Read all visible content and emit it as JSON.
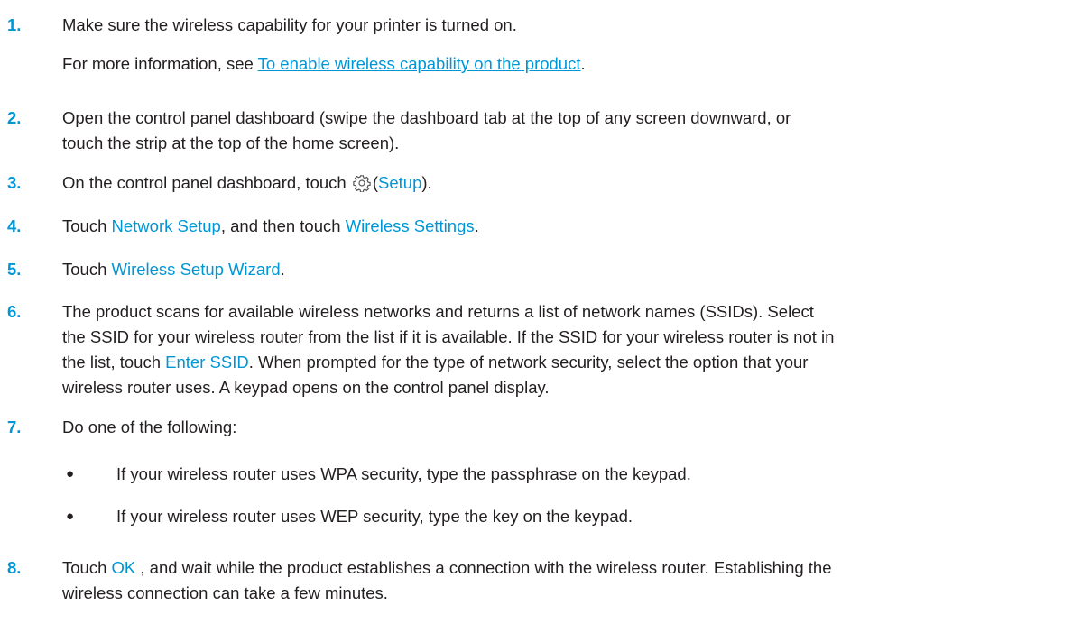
{
  "steps": {
    "s1": {
      "num": "1.",
      "text": "Make sure the wireless capability for your printer is turned on.",
      "more_prefix": "For more information, see ",
      "more_link": "To enable wireless capability on the product",
      "more_suffix": "."
    },
    "s2": {
      "num": "2.",
      "line1": "Open the control panel dashboard (swipe the dashboard tab at the top of any screen downward, or",
      "line2": "touch the strip at the top of the home screen)."
    },
    "s3": {
      "num": "3.",
      "prefix": "On the control panel dashboard, touch ",
      "icon": "gear-icon",
      "open_paren": "(",
      "ui": "Setup",
      "suffix": ")."
    },
    "s4": {
      "num": "4.",
      "prefix": "Touch ",
      "ui1": "Network Setup",
      "middle": ", and then touch ",
      "ui2": "Wireless Settings",
      "suffix": "."
    },
    "s5": {
      "num": "5.",
      "prefix": "Touch ",
      "ui": "Wireless Setup Wizard",
      "suffix": "."
    },
    "s6": {
      "num": "6.",
      "line1": "The product scans for available wireless networks and returns a list of network names (SSIDs). Select",
      "line2": "the SSID for your wireless router from the list if it is available. If the SSID for your wireless router is not in",
      "line3_prefix": "the list, touch ",
      "line3_ui": "Enter SSID",
      "line3_suffix": ". When prompted for the type of network security, select the option that your",
      "line4": "wireless router uses. A keypad opens on the control panel display."
    },
    "s7": {
      "num": "7.",
      "text": "Do one of the following:",
      "bullets": [
        "If your wireless router uses WPA security, type the passphrase on the keypad.",
        "If your wireless router uses WEP security, type the key on the keypad."
      ],
      "bullet_glyph": "●"
    },
    "s8": {
      "num": "8.",
      "prefix": "Touch ",
      "ui": "OK",
      "line1_suffix": " , and wait while the product establishes a connection with the wireless router. Establishing the",
      "line2": "wireless connection can take a few minutes."
    }
  },
  "colors": {
    "accent": "#0096d6",
    "text": "#231f20"
  }
}
